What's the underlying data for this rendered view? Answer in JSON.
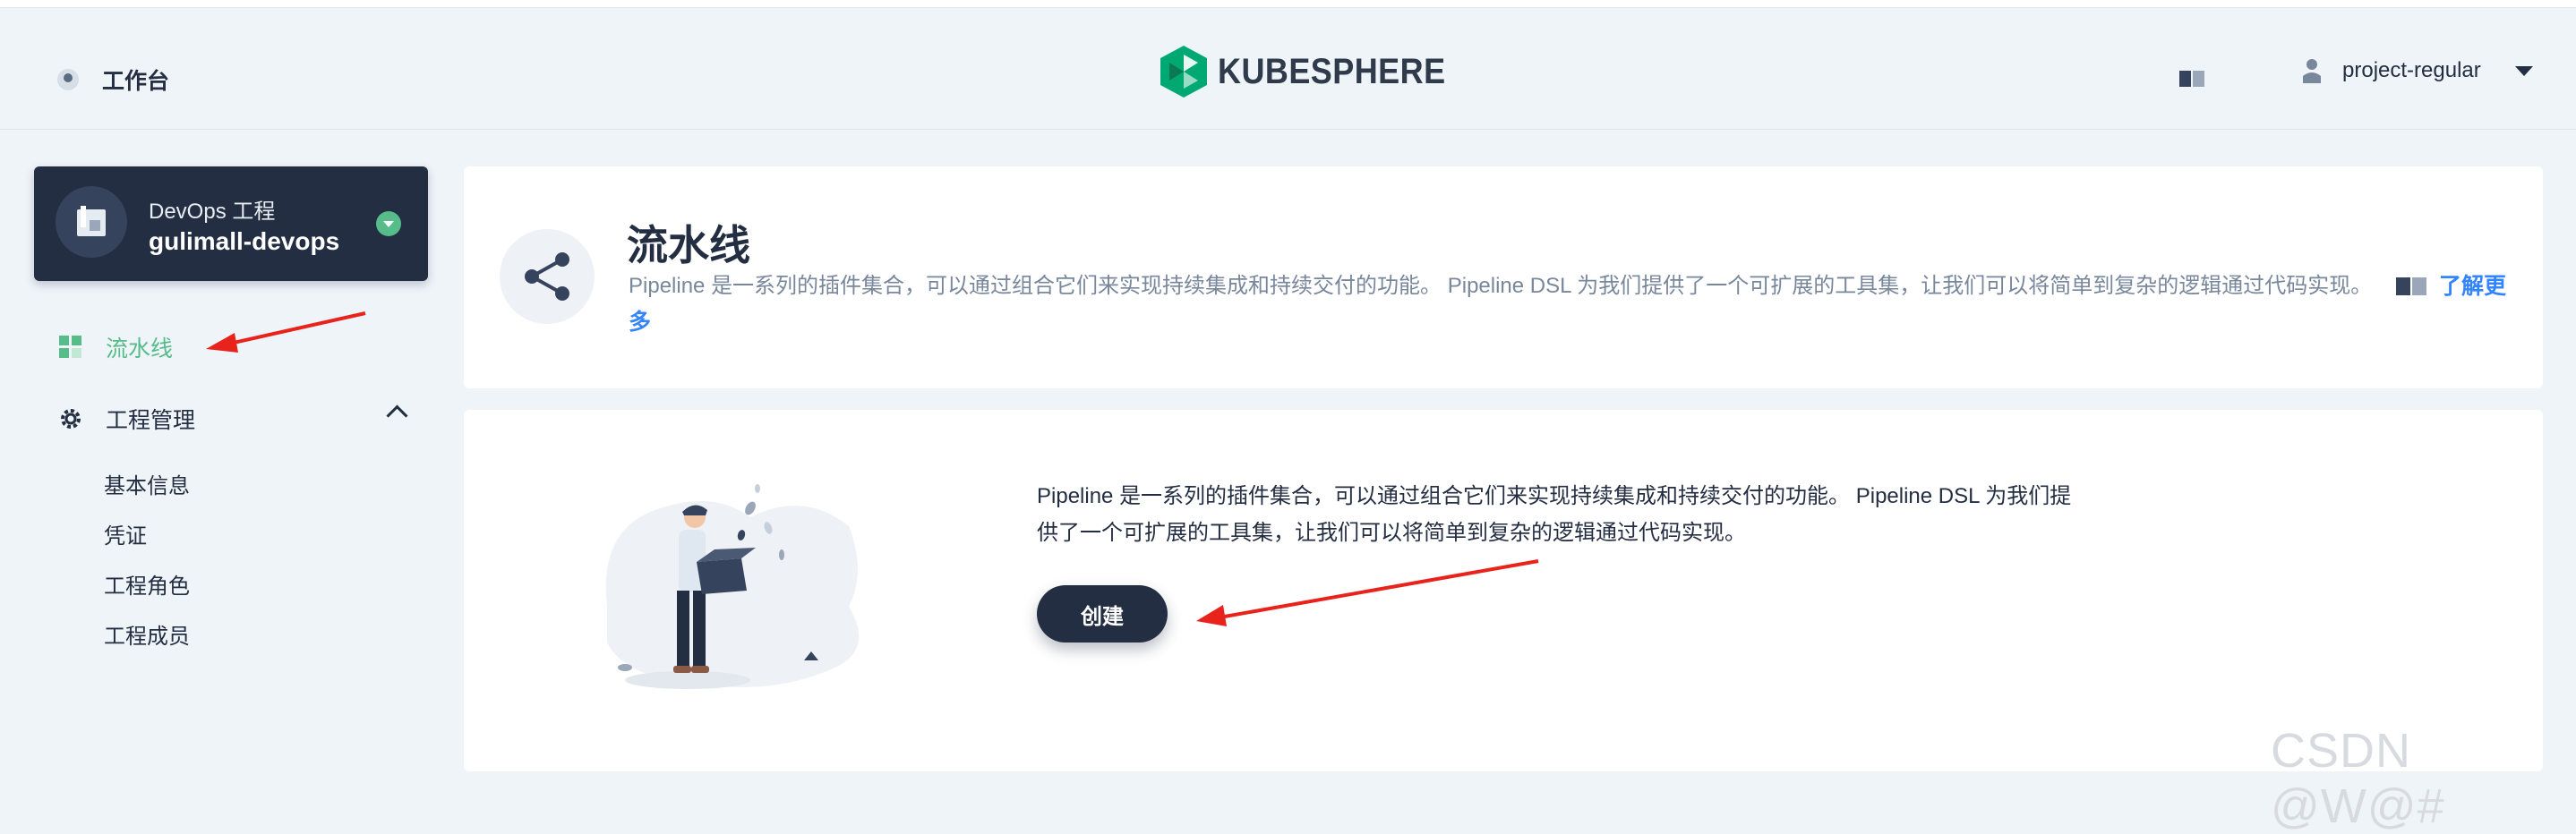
{
  "header": {
    "workspace_label": "工作台",
    "brand": "KUBESPHERE",
    "user_name": "project-regular"
  },
  "project": {
    "type_label": "DevOps 工程",
    "name": "gulimall-devops"
  },
  "sidebar": {
    "pipeline_label": "流水线",
    "group_label": "工程管理",
    "items": [
      "基本信息",
      "凭证",
      "工程角色",
      "工程成员"
    ]
  },
  "intro": {
    "title": "流水线",
    "description": "Pipeline 是一系列的插件集合，可以通过组合它们来实现持续集成和持续交付的功能。 Pipeline DSL 为我们提供了一个可扩展的工具集，让我们可以将简单到复杂的逻辑通过代码实现。",
    "learn_more_a": "了解更",
    "learn_more_b": "多"
  },
  "empty": {
    "line1": "Pipeline 是一系列的插件集合，可以通过组合它们来实现持续集成和持续交付的功能。 Pipeline DSL 为我们提",
    "line2": "供了一个可扩展的工具集，让我们可以将简单到复杂的逻辑通过代码实现。",
    "create_label": "创建"
  },
  "watermark": "CSDN @W@#",
  "colors": {
    "accent_green": "#55bc8a",
    "dark": "#242e42",
    "link_blue": "#3385ff",
    "annotation_red": "#e8231c"
  }
}
